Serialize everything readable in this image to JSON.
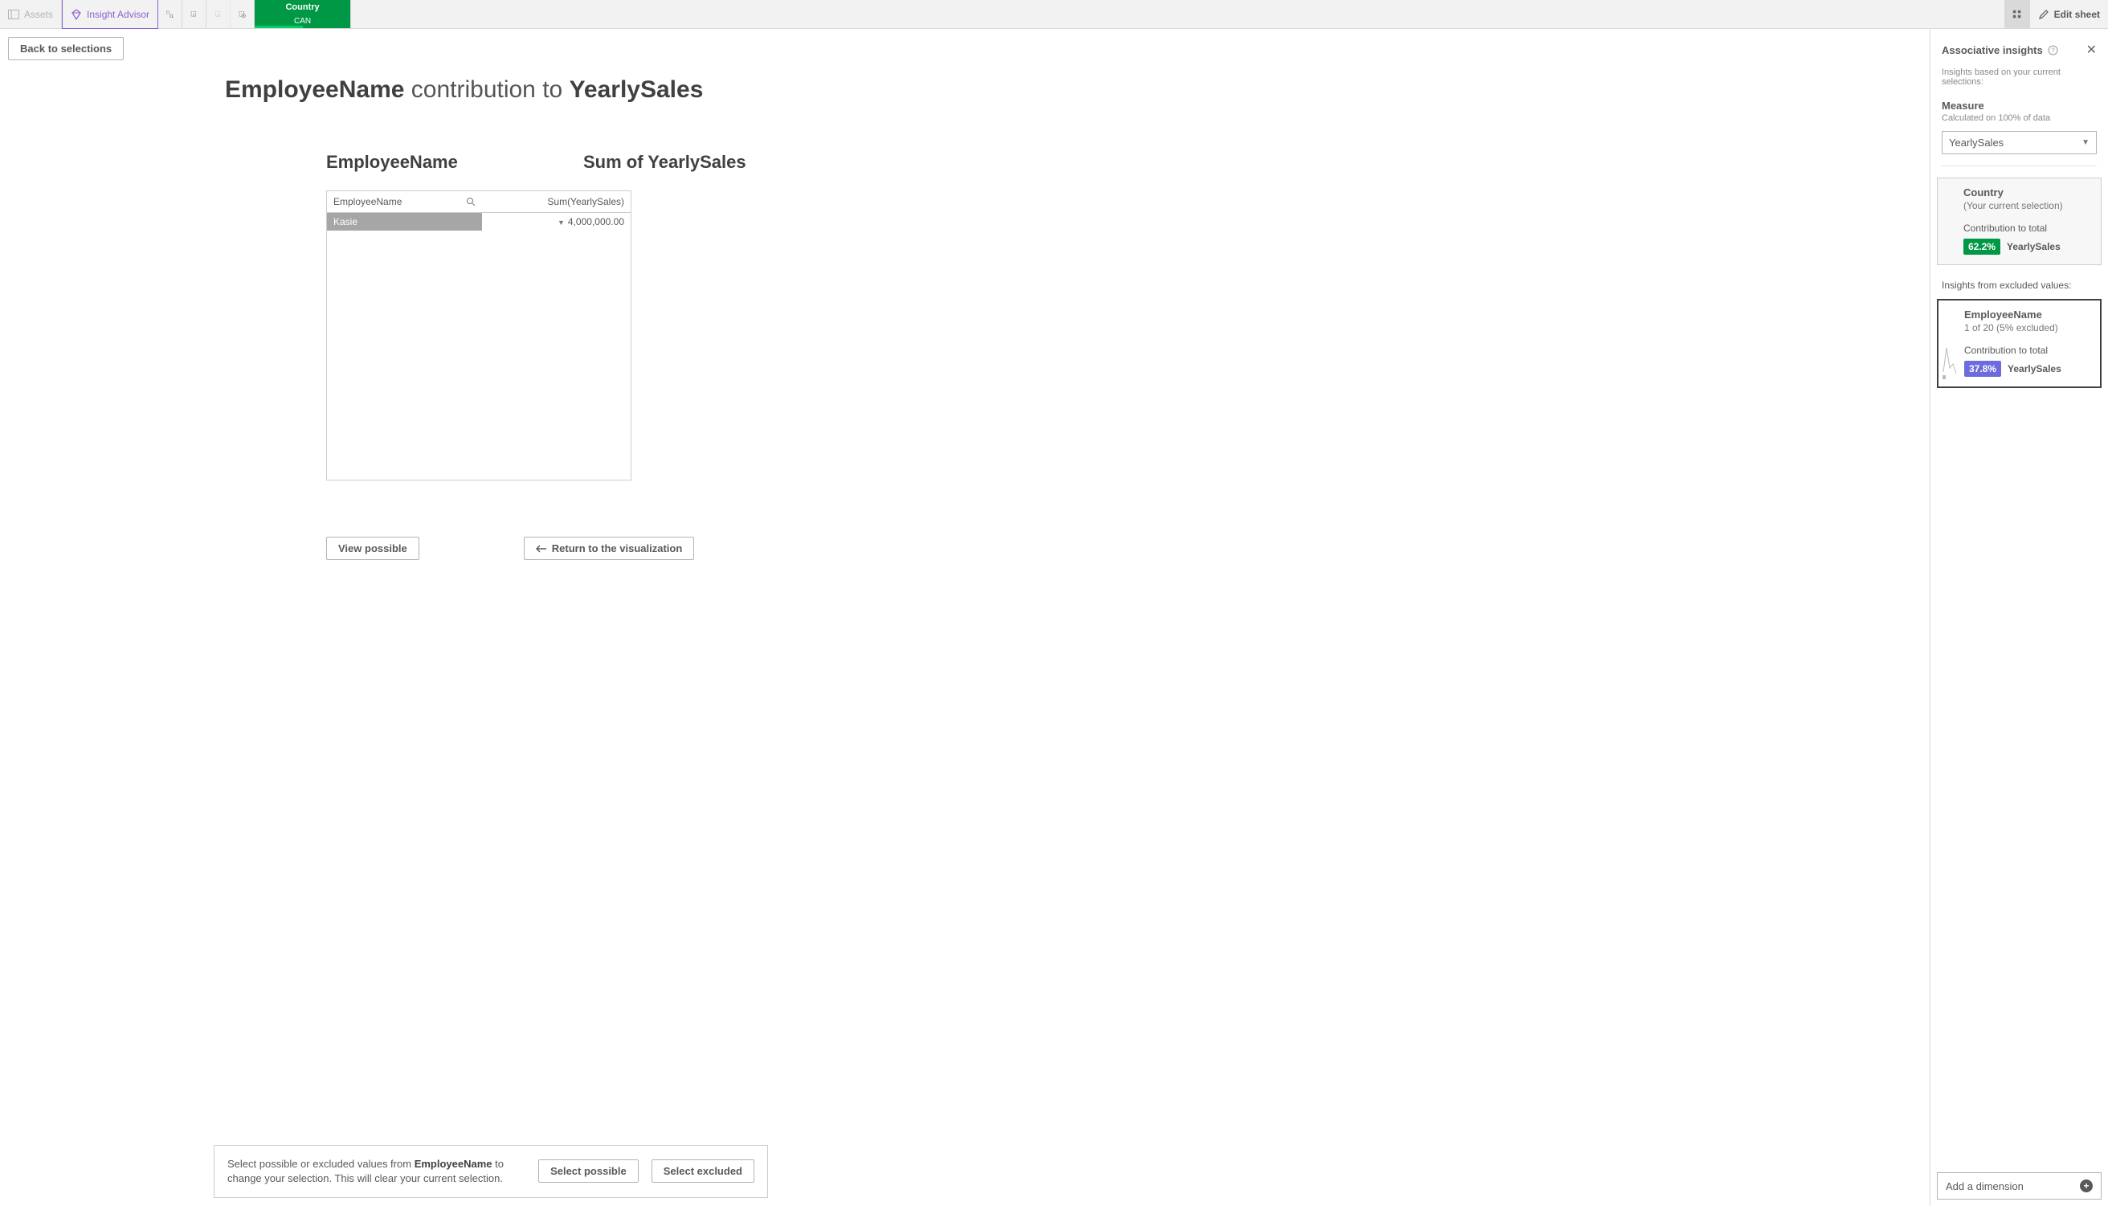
{
  "toolbar": {
    "assets_label": "Assets",
    "insight_advisor_label": "Insight Advisor",
    "selection_field": "Country",
    "selection_value": "CAN",
    "edit_sheet_label": "Edit sheet"
  },
  "back_button": "Back to selections",
  "page_title": {
    "part1": "EmployeeName",
    "part2": " contribution to ",
    "part3": "YearlySales"
  },
  "columns": {
    "left_header": "EmployeeName",
    "right_header": "Sum of YearlySales"
  },
  "table": {
    "header_left": "EmployeeName",
    "header_right": "Sum(YearlySales)",
    "rows": [
      {
        "name": "Kasie",
        "value": "4,000,000.00"
      }
    ]
  },
  "action_buttons": {
    "view_possible": "View possible",
    "return_viz": "Return to the visualization"
  },
  "hint": {
    "prefix": "Select possible or excluded values from ",
    "field": "EmployeeName",
    "suffix": " to change your selection. This will clear your current selection.",
    "select_possible": "Select possible",
    "select_excluded": "Select excluded"
  },
  "panel": {
    "title": "Associative insights",
    "subtitle": "Insights based on your current selections:",
    "measure_label": "Measure",
    "measure_hint": "Calculated on 100% of data",
    "measure_value": "YearlySales",
    "excluded_header": "Insights from excluded values:",
    "card1": {
      "title": "Country",
      "sub": "(Your current selection)",
      "contrib_label": "Contribution to total",
      "badge": "62.2%",
      "measure": "YearlySales"
    },
    "card2": {
      "title": "EmployeeName",
      "sub": "1 of 20 (5% excluded)",
      "contrib_label": "Contribution to total",
      "badge": "37.8%",
      "measure": "YearlySales"
    },
    "add_dimension": "Add a dimension"
  },
  "chart_data": {
    "type": "table",
    "title": "EmployeeName contribution to YearlySales",
    "columns": [
      "EmployeeName",
      "Sum(YearlySales)"
    ],
    "rows": [
      [
        "Kasie",
        4000000.0
      ]
    ]
  }
}
